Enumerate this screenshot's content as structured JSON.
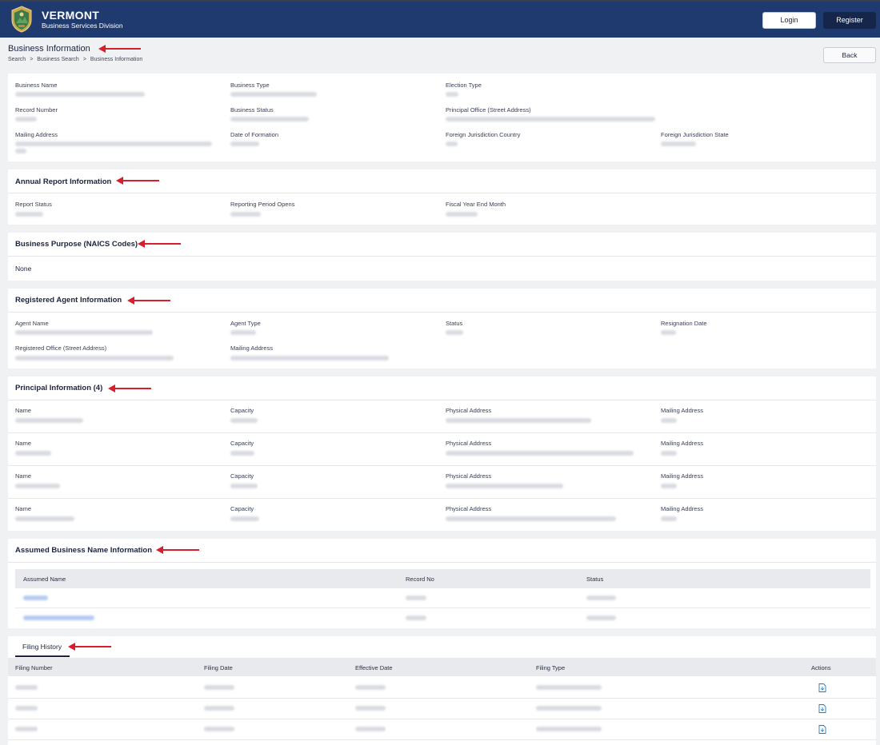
{
  "header": {
    "brand_title": "VERMONT",
    "brand_subtitle": "Business Services Division",
    "login_label": "Login",
    "register_label": "Register",
    "logo_icon": "vermont-seal-icon",
    "colors": {
      "header_bg": "#1f3a6e",
      "register_bg": "#16254a",
      "annotation_arrow": "#d61f2c"
    }
  },
  "page": {
    "title": "Business Information",
    "back_label": "Back",
    "breadcrumb": [
      "Search",
      "Business Search",
      "Business Information"
    ],
    "breadcrumb_separator": ">"
  },
  "business_info": {
    "fields": [
      {
        "label": "Business Name"
      },
      {
        "label": "Business Type"
      },
      {
        "label": "Election Type"
      },
      {
        "label": "Record Number"
      },
      {
        "label": "Business Status"
      },
      {
        "label": "Principal Office (Street Address)"
      },
      {
        "label": "Mailing Address"
      },
      {
        "label": "Date of Formation"
      },
      {
        "label": "Foreign Jurisdiction Country"
      },
      {
        "label": "Foreign Jurisdiction State"
      }
    ]
  },
  "annual_report": {
    "title": "Annual Report Information",
    "fields": [
      {
        "label": "Report Status"
      },
      {
        "label": "Reporting Period Opens"
      },
      {
        "label": "Fiscal Year End Month"
      }
    ]
  },
  "naics": {
    "title": "Business Purpose (NAICS Codes)",
    "value": "None"
  },
  "registered_agent": {
    "title": "Registered Agent Information",
    "fields": [
      {
        "label": "Agent Name"
      },
      {
        "label": "Agent Type"
      },
      {
        "label": "Status"
      },
      {
        "label": "Resignation Date"
      },
      {
        "label": "Registered Office (Street Address)"
      },
      {
        "label": "Mailing Address"
      }
    ]
  },
  "principals": {
    "title": "Principal Information (4)",
    "labels": {
      "name": "Name",
      "capacity": "Capacity",
      "physical": "Physical Address",
      "mailing": "Mailing Address"
    }
  },
  "assumed_names": {
    "title": "Assumed Business Name Information",
    "columns": [
      "Assumed Name",
      "Record No",
      "Status"
    ]
  },
  "filing_history": {
    "tab_label": "Filing History",
    "columns": [
      "Filing Number",
      "Filing Date",
      "Effective Date",
      "Filing Type",
      "Actions"
    ],
    "action_icon": "document-download-icon"
  }
}
